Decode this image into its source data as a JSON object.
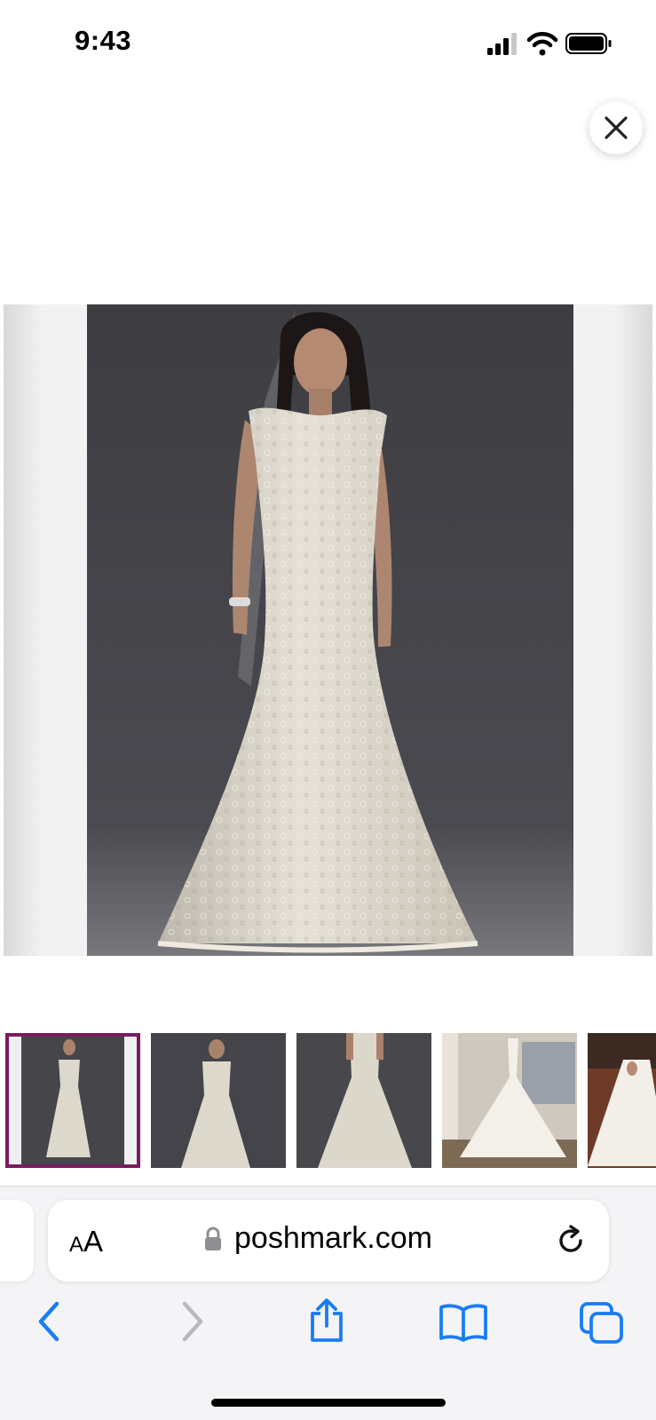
{
  "status_bar": {
    "time": "9:43",
    "icons": [
      "cellular-signal-icon",
      "wifi-icon",
      "battery-icon"
    ]
  },
  "viewer": {
    "close_icon": "close-icon",
    "main_image": "wedding-dress-photo-1",
    "thumbnails": [
      {
        "name": "wedding-dress-photo-1",
        "selected": true
      },
      {
        "name": "wedding-dress-photo-2",
        "selected": false
      },
      {
        "name": "wedding-dress-photo-3",
        "selected": false
      },
      {
        "name": "wedding-dress-photo-4",
        "selected": false
      },
      {
        "name": "wedding-dress-photo-5",
        "selected": false
      }
    ],
    "selected_color": "#7a1b5e"
  },
  "browser": {
    "reader_small": "A",
    "reader_big": "A",
    "url": "poshmark.com",
    "accent_color": "#1a7cf5",
    "nav_icons": [
      "back-icon",
      "forward-icon",
      "share-icon",
      "bookmarks-icon",
      "tabs-icon"
    ]
  }
}
